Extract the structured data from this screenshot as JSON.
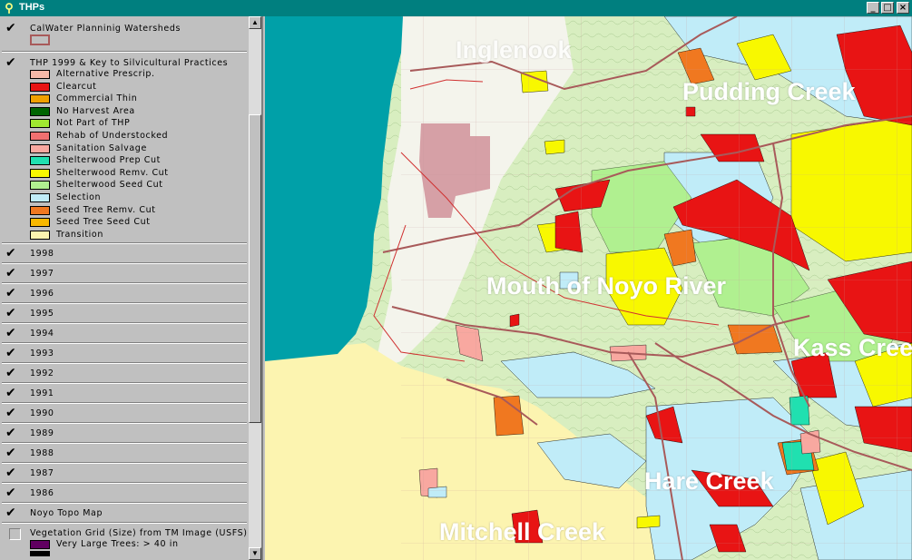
{
  "window": {
    "title": "THPs",
    "buttons": [
      "_",
      "□",
      "×"
    ]
  },
  "legend": {
    "groups": [
      {
        "label": "CalWater Planninig Watersheds",
        "checked": true,
        "swatch": "#a85a5a"
      },
      {
        "label": "THP 1999 & Key to Silvicultural Practices",
        "checked": true
      }
    ],
    "thp_items": [
      {
        "label": "Alternative Prescrip.",
        "color": "#f4b8a8"
      },
      {
        "label": "Clearcut",
        "color": "#e81414"
      },
      {
        "label": "Commercial Thin",
        "color": "#f0a000"
      },
      {
        "label": "No Harvest Area",
        "color": "#006400"
      },
      {
        "label": "Not Part of THP",
        "color": "#a0e830"
      },
      {
        "label": "Rehab of Understocked",
        "color": "#f07070"
      },
      {
        "label": "Sanitation Salvage",
        "color": "#f8a8a0"
      },
      {
        "label": "Shelterwood Prep Cut",
        "color": "#20e0b0"
      },
      {
        "label": "Shelterwood Remv. Cut",
        "color": "#f8f800"
      },
      {
        "label": "Shelterwood Seed Cut",
        "color": "#b0f090"
      },
      {
        "label": "Selection",
        "color": "#c0ecf8"
      },
      {
        "label": "Seed Tree Remv. Cut",
        "color": "#f07820"
      },
      {
        "label": "Seed Tree Seed Cut",
        "color": "#f8b800"
      },
      {
        "label": "Transition",
        "color": "#fcf4b0"
      }
    ],
    "years": [
      "1998",
      "1997",
      "1996",
      "1995",
      "1994",
      "1993",
      "1992",
      "1991",
      "1990",
      "1989",
      "1988",
      "1987",
      "1986"
    ],
    "topo": {
      "label": "Noyo Topo Map",
      "checked": true
    },
    "vegetation": {
      "label": "Vegetation Grid (Size) from TM Image (USFS)",
      "checked": false,
      "first_item": "Very Large Trees: > 40  in",
      "first_color": "#600060",
      "second_color": "#000000"
    }
  },
  "map": {
    "labels": [
      "Pudding Creek",
      "Mouth of Noyo River",
      "Kass Cree",
      "Hare Creek",
      "Mitchell Creek",
      "Inglenook"
    ],
    "ocean_color": "#00a0a8",
    "land_color": "#d8eec0"
  }
}
